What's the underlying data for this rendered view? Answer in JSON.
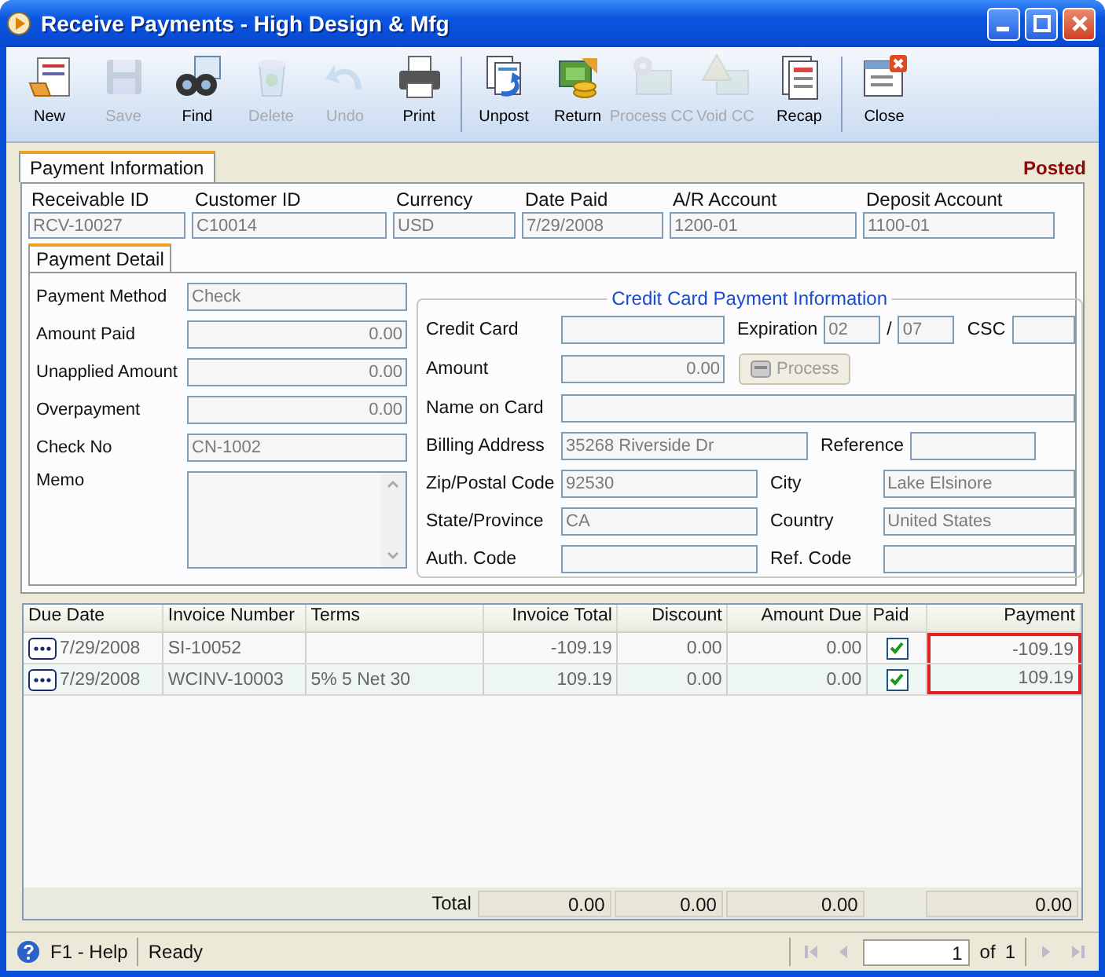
{
  "window": {
    "title": "Receive Payments - High Design & Mfg"
  },
  "toolbar": [
    [
      {
        "label": "New",
        "disabled": false
      },
      {
        "label": "Save",
        "disabled": true
      },
      {
        "label": "Find",
        "disabled": false
      },
      {
        "label": "Delete",
        "disabled": true
      },
      {
        "label": "Undo",
        "disabled": true
      },
      {
        "label": "Print",
        "disabled": false
      }
    ],
    [
      {
        "label": "Unpost",
        "disabled": false
      },
      {
        "label": "Return",
        "disabled": false
      },
      {
        "label": "Process CC",
        "disabled": true
      },
      {
        "label": "Void CC",
        "disabled": true
      },
      {
        "label": "Recap",
        "disabled": false
      }
    ],
    [
      {
        "label": "Close",
        "disabled": false
      }
    ]
  ],
  "main_tab": {
    "label": "Payment Information",
    "selected": true
  },
  "status": "Posted",
  "header_fields": [
    {
      "label": "Receivable ID",
      "value": "RCV-10027"
    },
    {
      "label": "Customer ID",
      "value": "C10014"
    },
    {
      "label": "Currency",
      "value": "USD"
    },
    {
      "label": "Date Paid",
      "value": "7/29/2008"
    },
    {
      "label": "A/R Account",
      "value": "1200-01"
    },
    {
      "label": "Deposit Account",
      "value": "1100-01"
    }
  ],
  "detail_tab": {
    "label": "Payment Detail",
    "selected": true
  },
  "detail_fields": [
    {
      "label": "Payment Method",
      "value": "Check",
      "kind": "text"
    },
    {
      "label": "Amount Paid",
      "value": "0.00",
      "kind": "amount"
    },
    {
      "label": "Unapplied Amount",
      "value": "0.00",
      "kind": "amount"
    },
    {
      "label": "Overpayment",
      "value": "0.00",
      "kind": "amount"
    },
    {
      "label": "Check No",
      "value": "CN-1002",
      "kind": "text"
    },
    {
      "label": "Memo",
      "kind": "memo"
    }
  ],
  "credit_card": {
    "title": "Credit Card Payment Information",
    "rows": [
      {
        "fields": [
          {
            "kind": "medium",
            "label": "Credit Card"
          },
          {
            "kind": "expiration",
            "label": "Expiration",
            "month": "02",
            "separator": "/",
            "year": "07"
          },
          {
            "kind": "small",
            "label": "CSC"
          }
        ]
      },
      {
        "fields": [
          {
            "kind": "amount",
            "label": "Amount",
            "value": "0.00"
          },
          {
            "kind": "button",
            "label": "Process",
            "disabled": true
          }
        ]
      },
      {
        "fields": [
          {
            "kind": "wide",
            "label": "Name on Card"
          }
        ]
      },
      {
        "fields": [
          {
            "kind": "long",
            "label": "Billing Address",
            "value": "35268 Riverside Dr"
          },
          {
            "kind": "ref",
            "label": "Reference"
          }
        ]
      },
      {
        "fields": [
          {
            "kind": "field",
            "label": "Zip/Postal Code",
            "value": "92530"
          },
          {
            "kind": "field2",
            "label": "City",
            "value": "Lake Elsinore"
          }
        ]
      },
      {
        "fields": [
          {
            "kind": "field",
            "label": "State/Province",
            "value": "CA"
          },
          {
            "kind": "field2",
            "label": "Country",
            "value": "United States"
          }
        ]
      },
      {
        "fields": [
          {
            "kind": "field",
            "label": "Auth. Code"
          },
          {
            "kind": "field2",
            "label": "Ref. Code"
          }
        ]
      }
    ]
  },
  "table": {
    "columns": [
      {
        "label": "Due Date",
        "highlighted": false
      },
      {
        "label": "Invoice Number",
        "highlighted": false
      },
      {
        "label": "Terms",
        "highlighted": false
      },
      {
        "label": "Invoice Total",
        "highlighted": false
      },
      {
        "label": "Discount",
        "highlighted": false
      },
      {
        "label": "Amount Due",
        "highlighted": false
      },
      {
        "label": "Paid",
        "highlighted": false
      },
      {
        "label": "Payment",
        "highlighted": true
      }
    ],
    "rows": [
      {
        "due_date": "7/29/2008",
        "invoice": "SI-10052",
        "total": "-109.19",
        "discount": "0.00",
        "amount_due": "0.00",
        "paid": true,
        "payment": "-109.19"
      },
      {
        "due_date": "7/29/2008",
        "invoice": "WCINV-10003",
        "terms": "5% 5 Net 30",
        "total": "109.19",
        "discount": "0.00",
        "amount_due": "0.00",
        "paid": true,
        "payment": "109.19"
      }
    ],
    "totals": {
      "label": "Total",
      "total": "0.00",
      "discount": "0.00",
      "amount_due": "0.00",
      "payment": "0.00"
    }
  },
  "status_bar": {
    "help": "F1 - Help",
    "message": "Ready",
    "page": "1",
    "of": "of",
    "pages": "1"
  }
}
